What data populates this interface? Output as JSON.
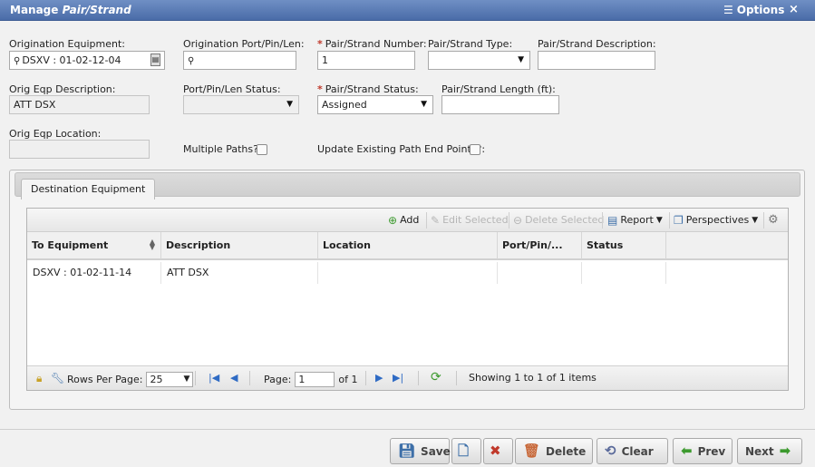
{
  "window": {
    "title_prefix": "Manage",
    "title_entity": "Pair/Strand",
    "options_label": "Options",
    "close_glyph": "×"
  },
  "form": {
    "orig_equipment": {
      "label": "Origination Equipment:",
      "value": "DSXV : 01-02-12-04"
    },
    "orig_port": {
      "label": "Origination Port/Pin/Len:",
      "value": ""
    },
    "pair_number": {
      "label": "Pair/Strand Number:",
      "value": "1"
    },
    "pair_type": {
      "label": "Pair/Strand Type:",
      "value": ""
    },
    "pair_description": {
      "label": "Pair/Strand Description:",
      "value": ""
    },
    "orig_eqp_description": {
      "label": "Orig Eqp Description:",
      "value": "ATT DSX"
    },
    "port_status": {
      "label": "Port/Pin/Len Status:",
      "value": ""
    },
    "pair_status": {
      "label": "Pair/Strand Status:",
      "value": "Assigned"
    },
    "pair_length": {
      "label": "Pair/Strand Length (ft):",
      "value": ""
    },
    "orig_eqp_location": {
      "label": "Orig Eqp Location:",
      "value": ""
    },
    "multiple_paths": {
      "label": "Multiple Paths?:",
      "checked": false
    },
    "update_endpoints": {
      "label": "Update Existing Path End Points?:",
      "checked": false
    },
    "required_marker": "*"
  },
  "tab": {
    "label": "Destination Equipment"
  },
  "grid": {
    "toolbar": {
      "add": "Add",
      "edit_selected": "Edit Selected",
      "delete_selected": "Delete Selected",
      "report": "Report",
      "perspectives": "Perspectives"
    },
    "columns": [
      "To Equipment",
      "Description",
      "Location",
      "Port/Pin/...",
      "Status"
    ],
    "rows": [
      {
        "to_equipment": "DSXV : 01-02-11-14",
        "description": "ATT DSX",
        "location": "",
        "port": "",
        "status": ""
      }
    ],
    "footer": {
      "rows_per_page_label": "Rows Per Page:",
      "rows_per_page": "25",
      "page_label": "Page:",
      "page": "1",
      "of_label": "of 1",
      "showing": "Showing 1 to 1 of 1 items"
    }
  },
  "buttons": {
    "save": "Save",
    "delete": "Delete",
    "clear": "Clear",
    "prev": "Prev",
    "next": "Next"
  },
  "colors": {
    "titlebar": "#4a6ca8",
    "required": "#c0392b",
    "add_icon": "#3c9a2e",
    "nav_icon": "#2f6bc4"
  },
  "icons": [
    "search-icon",
    "calendar-picker-icon",
    "list-icon",
    "close-icon",
    "add-icon",
    "edit-icon",
    "delete-icon",
    "report-icon",
    "perspectives-icon",
    "gear-icon",
    "lock-icon",
    "wrench-icon",
    "refresh-icon",
    "save-icon",
    "save-new-icon",
    "save-close-icon",
    "trash-icon",
    "clear-icon",
    "arrow-left-icon",
    "arrow-right-icon"
  ]
}
